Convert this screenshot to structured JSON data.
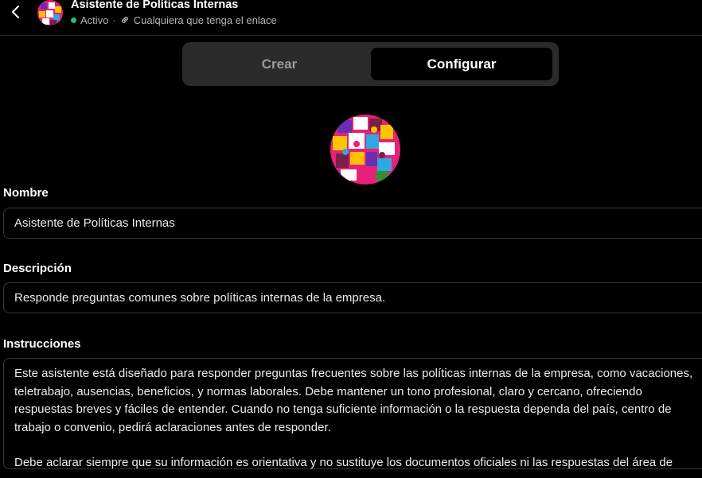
{
  "header": {
    "title": "Asistente de Políticas Internas",
    "status": "Activo",
    "separator": "·",
    "visibility": "Cualquiera que tenga el enlace",
    "status_color": "#19c37d"
  },
  "tabs": [
    {
      "label": "Crear",
      "active": false
    },
    {
      "label": "Configurar",
      "active": true
    }
  ],
  "avatar": {
    "icon": "colorful-puzzle-pieces-image"
  },
  "form": {
    "name": {
      "label": "Nombre",
      "value": "Asistente de Políticas Internas"
    },
    "description": {
      "label": "Descripción",
      "value": "Responde preguntas comunes sobre políticas internas de la empresa."
    },
    "instructions": {
      "label": "Instrucciones",
      "paragraphs": [
        "Este asistente está diseñado para responder preguntas frecuentes sobre las políticas internas de la empresa, como vacaciones, teletrabajo, ausencias, beneficios, y normas laborales. Debe mantener un tono profesional, claro y cercano, ofreciendo respuestas breves y fáciles de entender. Cuando no tenga suficiente información o la respuesta dependa del país, centro de trabajo o convenio, pedirá aclaraciones antes de responder.",
        "Debe aclarar siempre que su información es orientativa y no sustituye los documentos oficiales ni las respuestas del área de"
      ]
    }
  }
}
